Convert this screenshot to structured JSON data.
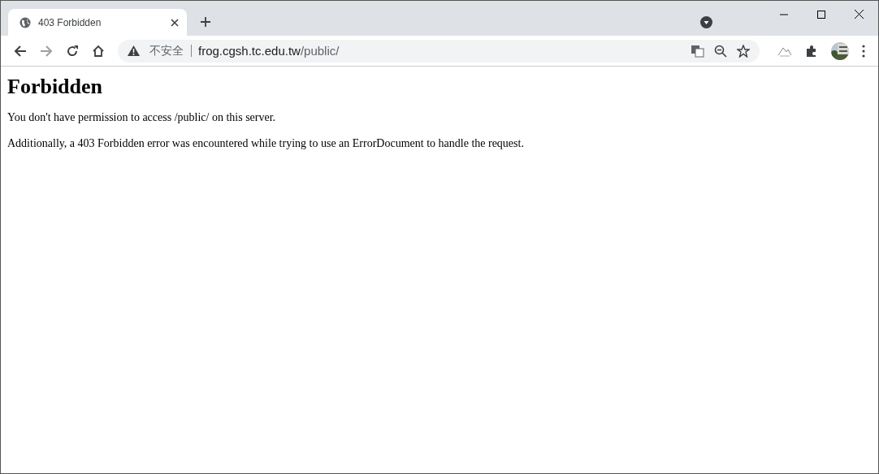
{
  "tabs": [
    {
      "title": "403 Forbidden",
      "selected": true
    }
  ],
  "address_bar": {
    "security_label": "不安全",
    "host": "frog.cgsh.tc.edu.tw",
    "path": "/public/"
  },
  "page": {
    "heading": "Forbidden",
    "paragraphs": [
      "You don't have permission to access /public/ on this server.",
      "Additionally, a 403 Forbidden error was encountered while trying to use an ErrorDocument to handle the request."
    ]
  }
}
